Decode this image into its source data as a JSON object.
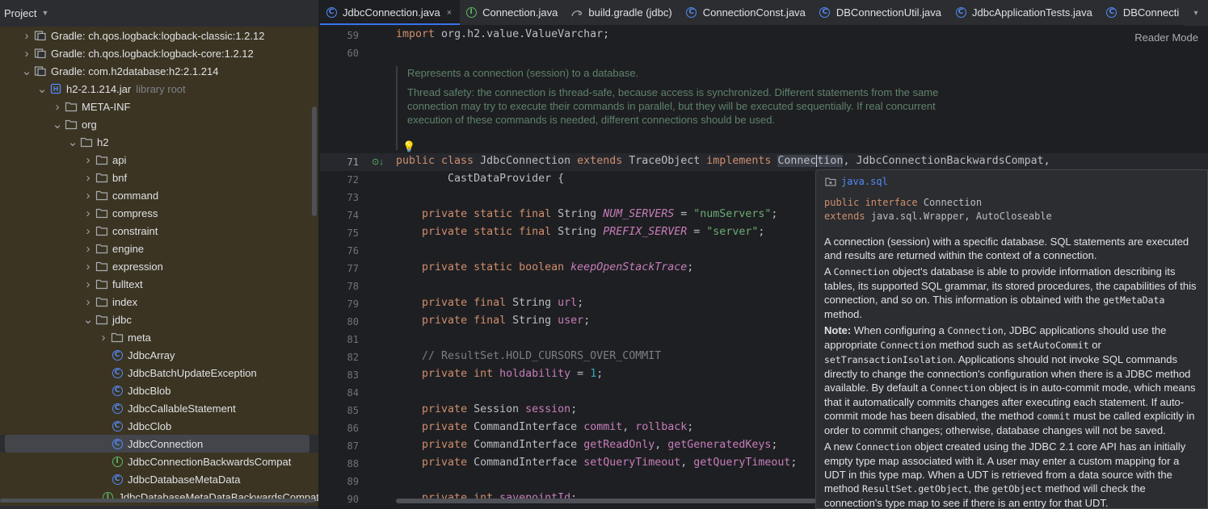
{
  "project": {
    "title": "Project",
    "tree": [
      {
        "label": "Gradle: ch.qos.logback:logback-classic:1.2.12",
        "icon": "library-icon"
      },
      {
        "label": "Gradle: ch.qos.logback:logback-core:1.2.12",
        "icon": "library-icon"
      },
      {
        "label": "Gradle: com.h2database:h2:2.1.214",
        "icon": "library-icon"
      },
      {
        "label": "h2-2.1.214.jar",
        "hint": "library root",
        "icon": "jar-icon"
      },
      {
        "label": "META-INF",
        "icon": "folder-icon"
      },
      {
        "label": "org",
        "icon": "folder-icon"
      },
      {
        "label": "h2",
        "icon": "folder-icon"
      },
      {
        "label": "api",
        "icon": "folder-icon"
      },
      {
        "label": "bnf",
        "icon": "folder-icon"
      },
      {
        "label": "command",
        "icon": "folder-icon"
      },
      {
        "label": "compress",
        "icon": "folder-icon"
      },
      {
        "label": "constraint",
        "icon": "folder-icon"
      },
      {
        "label": "engine",
        "icon": "folder-icon"
      },
      {
        "label": "expression",
        "icon": "folder-icon"
      },
      {
        "label": "fulltext",
        "icon": "folder-icon"
      },
      {
        "label": "index",
        "icon": "folder-icon"
      },
      {
        "label": "jdbc",
        "icon": "folder-icon"
      },
      {
        "label": "meta",
        "icon": "folder-icon"
      },
      {
        "label": "JdbcArray",
        "icon": "class-icon"
      },
      {
        "label": "JdbcBatchUpdateException",
        "icon": "class-icon"
      },
      {
        "label": "JdbcBlob",
        "icon": "class-icon"
      },
      {
        "label": "JdbcCallableStatement",
        "icon": "class-icon"
      },
      {
        "label": "JdbcClob",
        "icon": "class-icon"
      },
      {
        "label": "JdbcConnection",
        "icon": "class-icon"
      },
      {
        "label": "JdbcConnectionBackwardsCompat",
        "icon": "interface-icon"
      },
      {
        "label": "JdbcDatabaseMetaData",
        "icon": "class-icon"
      },
      {
        "label": "JdbcDatabaseMetaDataBackwardsCompat",
        "icon": "interface-icon"
      }
    ]
  },
  "tabs": [
    {
      "label": "JdbcConnection.java",
      "icon": "class-icon",
      "close": "×"
    },
    {
      "label": "Connection.java",
      "icon": "interface-icon"
    },
    {
      "label": "build.gradle (jdbc)",
      "icon": "gradle-icon"
    },
    {
      "label": "ConnectionConst.java",
      "icon": "gear-class-icon"
    },
    {
      "label": "DBConnectionUtil.java",
      "icon": "class-icon"
    },
    {
      "label": "JdbcApplicationTests.java",
      "icon": "class-icon"
    },
    {
      "label": "DBConnecti",
      "icon": "class-icon"
    }
  ],
  "editor": {
    "reader_mode": "Reader Mode",
    "line_numbers": [
      "59",
      "60",
      "71",
      "72",
      "73",
      "74",
      "75",
      "76",
      "77",
      "78",
      "79",
      "80",
      "81",
      "82",
      "83",
      "84",
      "85",
      "86",
      "87",
      "88",
      "89",
      "90"
    ],
    "doc_comment": {
      "p1": "Represents a connection (session) to a database.",
      "p2": "Thread safety: the connection is thread-safe, because access is synchronized. Different statements from the same connection may try to execute their commands in parallel, but they will be executed sequentially. If real concurrent execution of these commands is needed, different connections should be used."
    }
  },
  "doc_popup": {
    "package": "java.sql",
    "sig_kw1": "public interface",
    "sig_name": "Connection",
    "sig_kw2": "extends",
    "sig_ext": "java.sql.Wrapper, AutoCloseable",
    "p1": "A connection (session) with a specific database. SQL statements are executed and results are returned within the context of a connection.",
    "p2": {
      "a": "A ",
      "c1": "Connection",
      "b": " object's database is able to provide information describing its tables, its supported SQL grammar, its stored procedures, the capabilities of this connection, and so on. This information is obtained with the ",
      "c2": "getMetaData",
      "d": " method."
    },
    "p3": {
      "note": "Note:",
      "a": " When configuring a ",
      "c1": "Connection",
      "b": ", JDBC applications should use the appropriate ",
      "c2": "Connection",
      "c": " method such as ",
      "c3": "setAutoCommit",
      "d": " or ",
      "c4": "setTransactionIsolation",
      "e": ". Applications should not invoke SQL commands directly to change the connection's configuration when there is a JDBC method available. By default a ",
      "c5": "Connection",
      "f": " object is in auto-commit mode, which means that it automatically commits changes after executing each statement. If auto-commit mode has been disabled, the method ",
      "c6": "commit",
      "g": " must be called explicitly in order to commit changes; otherwise, database changes will not be saved."
    },
    "p4": {
      "a": "A new ",
      "c1": "Connection",
      "b": " object created using the JDBC 2.1 core API has an initially empty type map associated with it. A user may enter a custom mapping for a UDT in this type map. When a UDT is retrieved from a data source with the method ",
      "c2": "ResultSet.getObject",
      "c": ", the ",
      "c3": "getObject",
      "d": " method will check the connection's type map to see if there is an entry for that UDT."
    }
  }
}
